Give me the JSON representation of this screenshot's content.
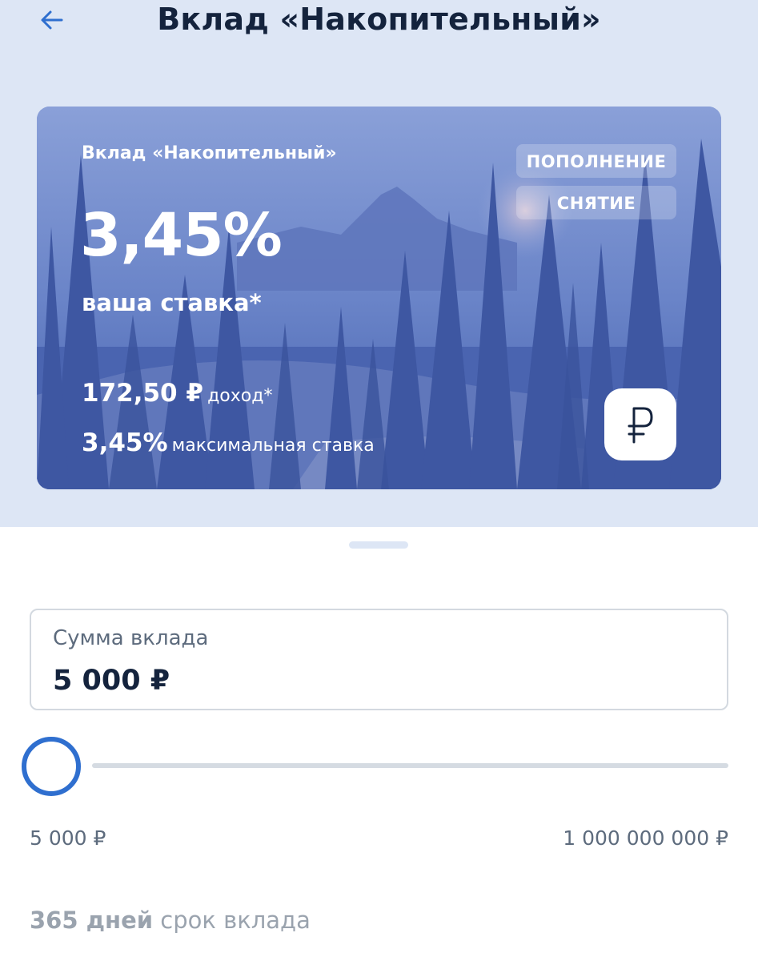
{
  "header": {
    "title": "Вклад «Накопительный»",
    "back_icon": "arrow-left-icon"
  },
  "card": {
    "name": "Вклад «Накопительный»",
    "rate": "3,45%",
    "rate_caption": "ваша ставка*",
    "income_value": "172,50 ₽",
    "income_caption": "доход*",
    "max_rate_value": "3,45%",
    "max_rate_caption": "максимальная ставка",
    "badges": [
      "ПОПОЛНЕНИЕ",
      "СНЯТИЕ"
    ],
    "currency_icon": "ruble-icon"
  },
  "amount": {
    "label": "Сумма вклада",
    "value": "5 000 ₽"
  },
  "slider": {
    "min_label": "5 000 ₽",
    "max_label": "1 000 000 000 ₽",
    "position": 0
  },
  "term": {
    "days": "365 дней",
    "caption": "срок вклада"
  },
  "colors": {
    "accent": "#2f6fcf",
    "header_bg": "#dde6f5",
    "card_blue": "#4762b2",
    "title_text": "#14233d"
  }
}
